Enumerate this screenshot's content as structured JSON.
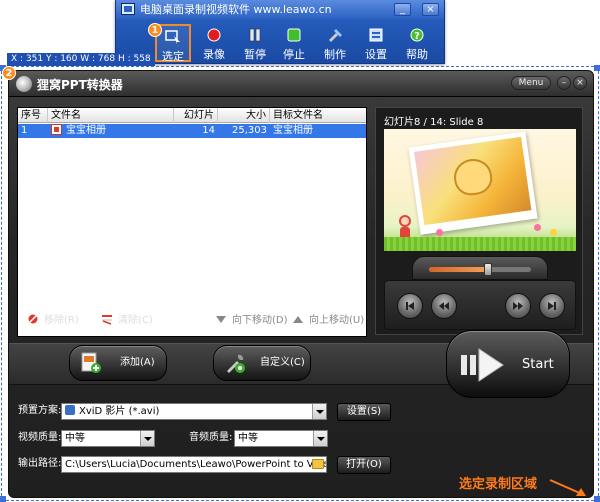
{
  "recorder": {
    "title": "电脑桌面录制视频软件 www.leawo.cn",
    "window_buttons": [
      "_",
      "×"
    ],
    "tools": [
      {
        "label": "选定",
        "icon": "select-area-icon",
        "selected": true
      },
      {
        "label": "录像",
        "icon": "record-icon",
        "selected": false
      },
      {
        "label": "暂停",
        "icon": "pause-icon",
        "selected": false
      },
      {
        "label": "停止",
        "icon": "stop-icon",
        "selected": false
      },
      {
        "label": "制作",
        "icon": "make-icon",
        "selected": false
      },
      {
        "label": "设置",
        "icon": "settings-icon",
        "selected": false
      },
      {
        "label": "帮助",
        "icon": "help-icon",
        "selected": false
      }
    ],
    "badge": "1"
  },
  "capture": {
    "coords": "X : 351  Y : 160  W : 768  H : 558",
    "badge": "2"
  },
  "converter": {
    "title": "狸窝PPT转换器",
    "menu_label": "Menu",
    "window_buttons": [
      "–",
      "×"
    ],
    "table": {
      "headers": [
        "序号",
        "文件名",
        "幻灯片数",
        "大小",
        "目标文件名"
      ],
      "rows": [
        {
          "index": "1",
          "filename": "宝宝相册",
          "slides": "14",
          "size": "25,303 KB",
          "target": "宝宝相册"
        }
      ]
    },
    "list_actions": {
      "remove": "移除(R)",
      "clear": "清除(C)",
      "move_down": "向下移动(D)",
      "move_up": "向上移动(U)"
    },
    "preview": {
      "label": "幻灯片8 / 14: Slide 8",
      "progress_fraction": 0.58
    },
    "buttons": {
      "add": "添加(A)",
      "customize": "自定义(C)"
    },
    "settings": {
      "preset_label": "预置方案:",
      "preset_value": "XviD 影片 (*.avi)",
      "settings_button": "设置(S)",
      "video_quality_label": "视频质量:",
      "video_quality_value": "中等",
      "audio_quality_label": "音频质量:",
      "audio_quality_value": "中等",
      "output_label": "输出路径:",
      "output_value": "C:\\Users\\Lucia\\Documents\\Leawo\\PowerPoint to Video",
      "open_button": "打开(O)"
    },
    "start_label": "Start"
  },
  "hint": {
    "text": "选定录制区域"
  },
  "colors": {
    "recorder_blue": "#1a4aa3",
    "highlight_orange": "#ff7a1a",
    "selected_row": "#3377e8"
  }
}
